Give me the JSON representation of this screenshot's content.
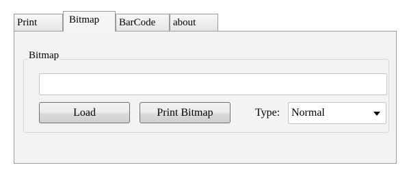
{
  "tabs": [
    {
      "label": "Print"
    },
    {
      "label": "Bitmap"
    },
    {
      "label": "BarCode"
    },
    {
      "label": "about"
    }
  ],
  "active_tab": "Bitmap",
  "bitmap_group": {
    "title": "Bitmap",
    "path_input": {
      "value": "",
      "placeholder": ""
    },
    "load_label": "Load",
    "print_label": "Print Bitmap",
    "type_label": "Type:",
    "type_value": "Normal"
  }
}
